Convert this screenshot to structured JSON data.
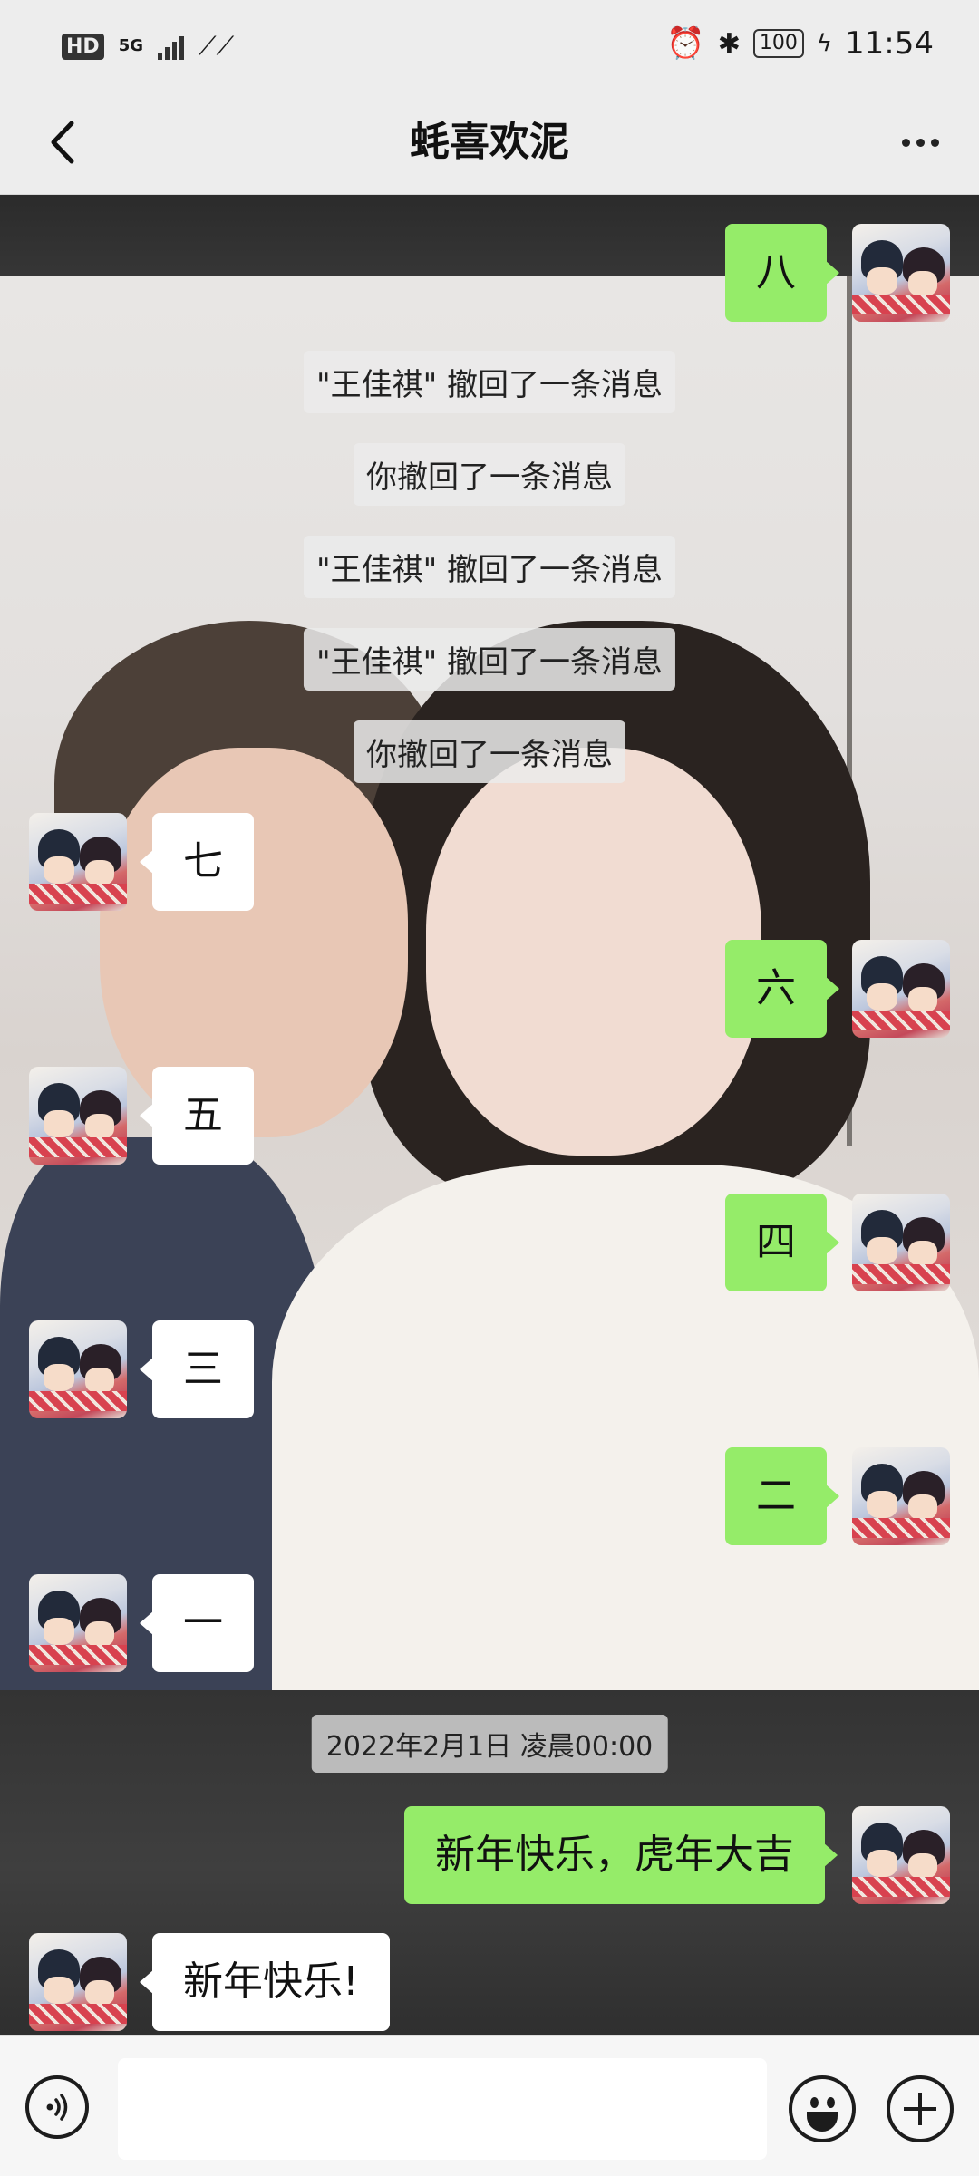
{
  "status_bar": {
    "hd": "HD",
    "network": "5G",
    "battery": "100",
    "time": "11:54"
  },
  "header": {
    "title": "蚝喜欢泥",
    "back_icon": "chevron-left-icon",
    "more_icon": "more-dots-icon"
  },
  "messages": {
    "m1": {
      "side": "right",
      "text": "八"
    },
    "notices": [
      "\"王佳祺\" 撤回了一条消息",
      "你撤回了一条消息",
      "\"王佳祺\" 撤回了一条消息",
      "\"王佳祺\" 撤回了一条消息",
      "你撤回了一条消息"
    ],
    "m2": {
      "side": "left",
      "text": "七"
    },
    "m3": {
      "side": "right",
      "text": "六"
    },
    "m4": {
      "side": "left",
      "text": "五"
    },
    "m5": {
      "side": "right",
      "text": "四"
    },
    "m6": {
      "side": "left",
      "text": "三"
    },
    "m7": {
      "side": "right",
      "text": "二"
    },
    "m8": {
      "side": "left",
      "text": "一"
    },
    "timestamp": "2022年2月1日 凌晨00:00",
    "m9": {
      "side": "right",
      "text": "新年快乐，虎年大吉"
    },
    "m10": {
      "side": "left",
      "text": "新年快乐!"
    }
  },
  "input_bar": {
    "voice_icon": "voice-icon",
    "emoji_icon": "emoji-icon",
    "plus_icon": "plus-icon",
    "message_value": ""
  },
  "colors": {
    "bubble_self": "#95ec69",
    "bubble_other": "#ffffff",
    "bar_bg": "#ededed"
  }
}
